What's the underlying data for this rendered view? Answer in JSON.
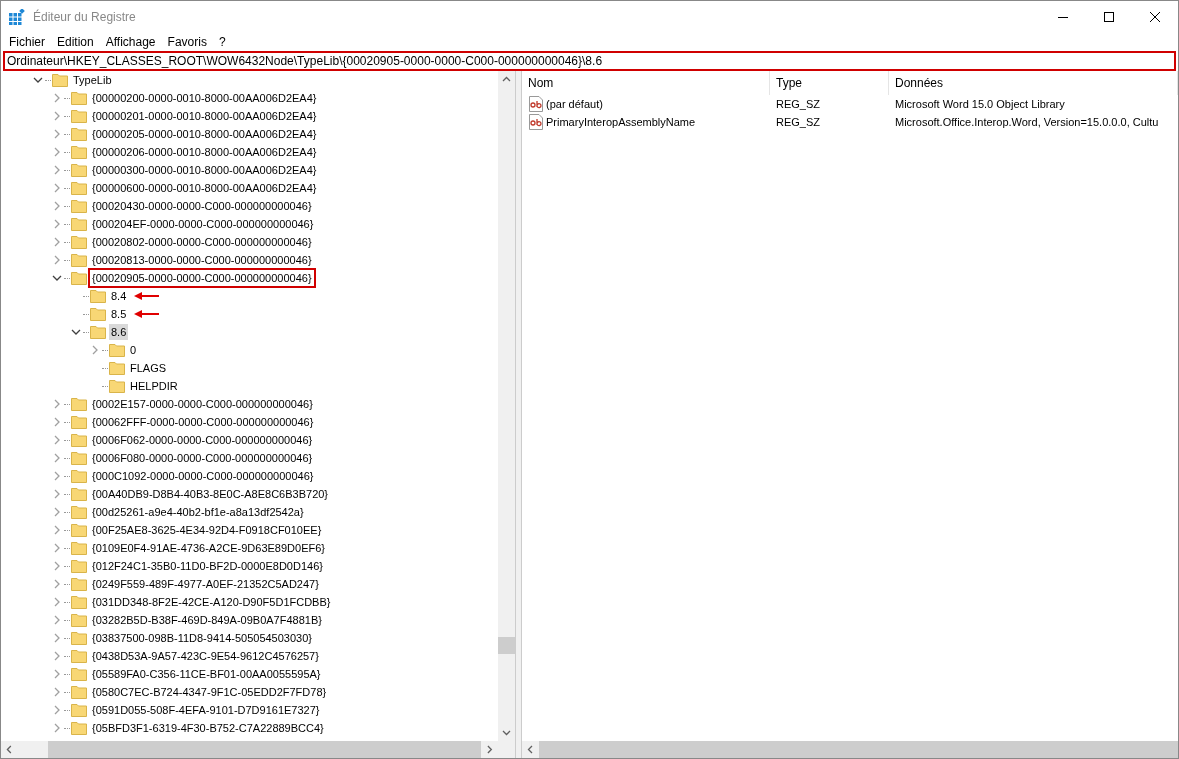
{
  "window": {
    "title": "Éditeur du Registre"
  },
  "menu": [
    "Fichier",
    "Edition",
    "Affichage",
    "Favoris",
    "?"
  ],
  "address_bar": {
    "value": "Ordinateur\\HKEY_CLASSES_ROOT\\WOW6432Node\\TypeLib\\{00020905-0000-0000-C000-000000000046}\\8.6",
    "outlined": true
  },
  "tree": [
    {
      "label": "TypeLib",
      "expanded": true,
      "selected": false,
      "children": [
        {
          "label": "{00000200-0000-0010-8000-00AA006D2EA4}",
          "expanded": false,
          "selected": false
        },
        {
          "label": "{00000201-0000-0010-8000-00AA006D2EA4}",
          "expanded": false,
          "selected": false
        },
        {
          "label": "{00000205-0000-0010-8000-00AA006D2EA4}",
          "expanded": false,
          "selected": false
        },
        {
          "label": "{00000206-0000-0010-8000-00AA006D2EA4}",
          "expanded": false,
          "selected": false
        },
        {
          "label": "{00000300-0000-0010-8000-00AA006D2EA4}",
          "expanded": false,
          "selected": false
        },
        {
          "label": "{00000600-0000-0010-8000-00AA006D2EA4}",
          "expanded": false,
          "selected": false
        },
        {
          "label": "{00020430-0000-0000-C000-000000000046}",
          "expanded": false,
          "selected": false
        },
        {
          "label": "{000204EF-0000-0000-C000-000000000046}",
          "expanded": false,
          "selected": false
        },
        {
          "label": "{00020802-0000-0000-C000-000000000046}",
          "expanded": false,
          "selected": false
        },
        {
          "label": "{00020813-0000-0000-C000-000000000046}",
          "expanded": false,
          "selected": false
        },
        {
          "label": "{00020905-0000-0000-C000-000000000046}",
          "expanded": true,
          "selected": false,
          "outlined": true,
          "children": [
            {
              "label": "8.4",
              "selected": false,
              "arrow": true
            },
            {
              "label": "8.5",
              "selected": false,
              "arrow": true
            },
            {
              "label": "8.6",
              "expanded": true,
              "selected": true,
              "children": [
                {
                  "label": "0",
                  "expanded": false,
                  "selected": false
                },
                {
                  "label": "FLAGS",
                  "selected": false
                },
                {
                  "label": "HELPDIR",
                  "selected": false
                }
              ]
            }
          ]
        },
        {
          "label": "{0002E157-0000-0000-C000-000000000046}",
          "expanded": false,
          "selected": false
        },
        {
          "label": "{00062FFF-0000-0000-C000-000000000046}",
          "expanded": false,
          "selected": false
        },
        {
          "label": "{0006F062-0000-0000-C000-000000000046}",
          "expanded": false,
          "selected": false
        },
        {
          "label": "{0006F080-0000-0000-C000-000000000046}",
          "expanded": false,
          "selected": false
        },
        {
          "label": "{000C1092-0000-0000-C000-000000000046}",
          "expanded": false,
          "selected": false
        },
        {
          "label": "{00A40DB9-D8B4-40B3-8E0C-A8E8C6B3B720}",
          "expanded": false,
          "selected": false
        },
        {
          "label": "{00d25261-a9e4-40b2-bf1e-a8a13df2542a}",
          "expanded": false,
          "selected": false
        },
        {
          "label": "{00F25AE8-3625-4E34-92D4-F0918CF010EE}",
          "expanded": false,
          "selected": false
        },
        {
          "label": "{0109E0F4-91AE-4736-A2CE-9D63E89D0EF6}",
          "expanded": false,
          "selected": false
        },
        {
          "label": "{012F24C1-35B0-11D0-BF2D-0000E8D0D146}",
          "expanded": false,
          "selected": false
        },
        {
          "label": "{0249F559-489F-4977-A0EF-21352C5AD247}",
          "expanded": false,
          "selected": false
        },
        {
          "label": "{031DD348-8F2E-42CE-A120-D90F5D1FCDBB}",
          "expanded": false,
          "selected": false
        },
        {
          "label": "{03282B5D-B38F-469D-849A-09B0A7F4881B}",
          "expanded": false,
          "selected": false
        },
        {
          "label": "{03837500-098B-11D8-9414-505054503030}",
          "expanded": false,
          "selected": false
        },
        {
          "label": "{0438D53A-9A57-423C-9E54-9612C4576257}",
          "expanded": false,
          "selected": false
        },
        {
          "label": "{05589FA0-C356-11CE-BF01-00AA0055595A}",
          "expanded": false,
          "selected": false
        },
        {
          "label": "{0580C7EC-B724-4347-9F1C-05EDD2F7FD78}",
          "expanded": false,
          "selected": false
        },
        {
          "label": "{0591D055-508F-4EFA-9101-D7D9161E7327}",
          "expanded": false,
          "selected": false
        },
        {
          "label": "{05BFD3F1-6319-4F30-B752-C7A22889BCC4}",
          "expanded": false,
          "selected": false
        }
      ]
    }
  ],
  "values": {
    "columns": [
      "Nom",
      "Type",
      "Données"
    ],
    "rows": [
      {
        "name": "(par défaut)",
        "type": "REG_SZ",
        "data": "Microsoft Word 15.0 Object Library"
      },
      {
        "name": "PrimaryInteropAssemblyName",
        "type": "REG_SZ",
        "data": "Microsoft.Office.Interop.Word, Version=15.0.0.0, Cultu"
      }
    ]
  }
}
